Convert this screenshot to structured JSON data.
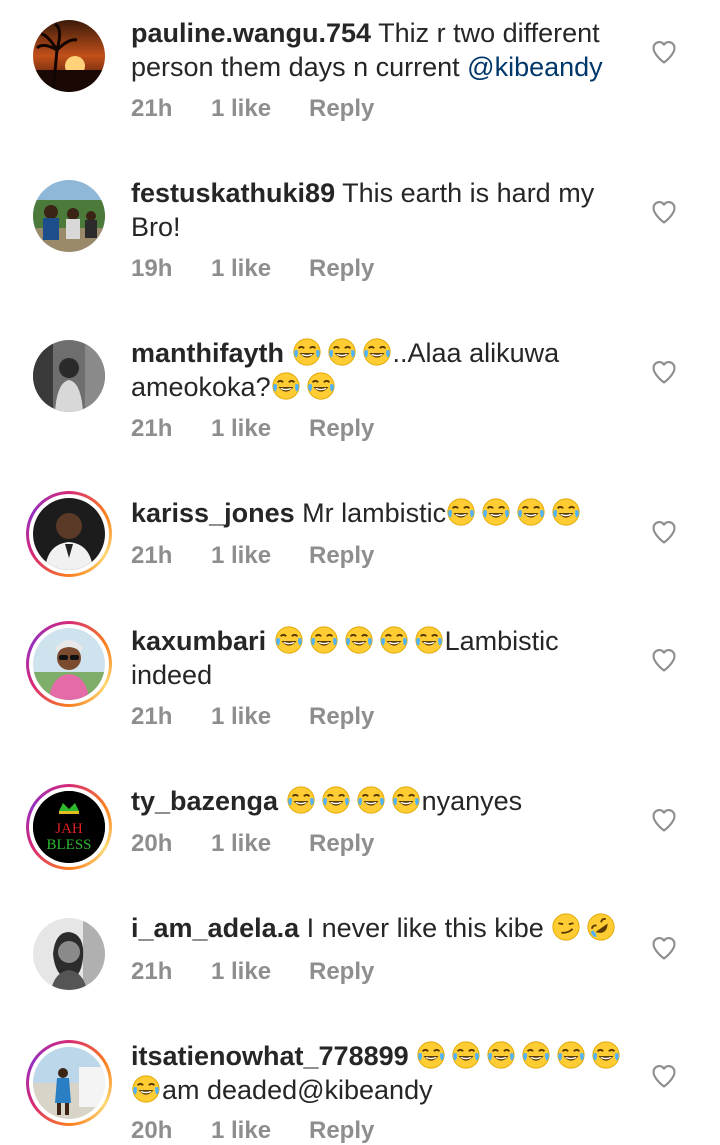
{
  "comments": [
    {
      "username": "pauline.wangu.754",
      "text": " Thiz r two different person them days n current ",
      "mention": "@kibeandy",
      "time": "21h",
      "likes": "1 like",
      "reply": "Reply",
      "avatar": "sunset-palm-photo"
    },
    {
      "username": "festuskathuki89",
      "text": " This earth is hard my Bro!",
      "time": "19h",
      "likes": "1 like",
      "reply": "Reply",
      "avatar": "group-photo"
    },
    {
      "username": "manthifayth",
      "emoji_before": "joy-emoji x3",
      "text": "..Alaa alikuwa ameokoka?",
      "emoji_after": "joy-emoji x2",
      "time": "21h",
      "likes": "1 like",
      "reply": "Reply",
      "avatar": "bw-portrait"
    },
    {
      "username": "kariss_jones",
      "text": " Mr lambistic",
      "emoji_after": "joy-emoji x4",
      "time": "21h",
      "likes": "1 like",
      "reply": "Reply",
      "avatar": "man-portrait-story"
    },
    {
      "username": "kaxumbari",
      "emoji_before": "joy-emoji x5",
      "text": "Lambistic indeed",
      "time": "21h",
      "likes": "1 like",
      "reply": "Reply",
      "avatar": "woman-sunglasses-story"
    },
    {
      "username": "ty_bazenga",
      "emoji_before": "joy-emoji x4",
      "text": "nyanyes",
      "time": "20h",
      "likes": "1 like",
      "reply": "Reply",
      "avatar": "jah-bless-logo",
      "avatar_text": [
        "JAH",
        "BLESS"
      ]
    },
    {
      "username": "i_am_adela.a",
      "text": " I never like this kibe ",
      "emoji_after": "smirk-emoji, rofl-emoji",
      "time": "21h",
      "likes": "1 like",
      "reply": "Reply",
      "avatar": "bw-woman-portrait"
    },
    {
      "username": "itsatienowhat_778899",
      "emoji_before": "joy-emoji x7",
      "text": "am deaded@kibeandy",
      "time": "20h",
      "likes": "1 like",
      "reply": "Reply",
      "avatar": "beach-photo-story"
    }
  ],
  "colors": {
    "text": "#262626",
    "meta": "#8e8e8e",
    "mention": "#00376b",
    "story_ring": "#d62976"
  }
}
